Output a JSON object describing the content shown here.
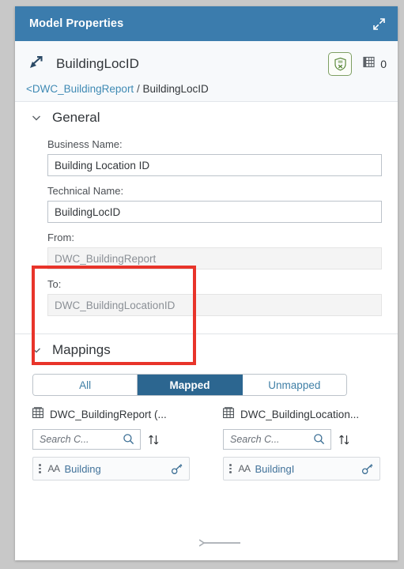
{
  "window": {
    "title": "Model Properties",
    "expand_icon": "expand-icon"
  },
  "object_header": {
    "type_icon": "association-arrow-icon",
    "name": "BuildingLocID",
    "shield_icon": "shield-validation-icon",
    "table_icon": "table-icon",
    "record_count": "0",
    "breadcrumb": {
      "parent_link": "<DWC_BuildingReport",
      "separator": "/",
      "current": "BuildingLocID"
    }
  },
  "general": {
    "title": "General",
    "chevron_icon": "chevron-down-icon",
    "fields": [
      {
        "label": "Business Name:",
        "value": "Building Location ID",
        "placeholder": "",
        "disabled": false,
        "name": "business-name-field"
      },
      {
        "label": "Technical Name:",
        "value": "BuildingLocID",
        "placeholder": "",
        "disabled": false,
        "name": "technical-name-field"
      },
      {
        "label": "From:",
        "value": "DWC_BuildingReport",
        "placeholder": "",
        "disabled": true,
        "name": "from-field"
      },
      {
        "label": "To:",
        "value": "DWC_BuildingLocationID",
        "placeholder": "",
        "disabled": true,
        "name": "to-field"
      }
    ]
  },
  "mappings": {
    "title": "Mappings",
    "chevron_icon": "chevron-down-icon",
    "filter_tabs": [
      {
        "label": "All",
        "active": false
      },
      {
        "label": "Mapped",
        "active": true
      },
      {
        "label": "Unmapped",
        "active": false
      }
    ],
    "source": {
      "entity_icon": "table-grid-icon",
      "entity_label": "DWC_BuildingReport (...",
      "search_placeholder": "Search C...",
      "search_value": "",
      "search_icon": "search-icon",
      "sort_icon": "sort-arrows-icon",
      "columns": [
        {
          "grip_icon": "drag-handle-icon",
          "type_icon": "AA",
          "label": "Building",
          "key_icon": "key-icon"
        }
      ]
    },
    "target": {
      "entity_icon": "table-grid-icon",
      "entity_label": "DWC_BuildingLocation...",
      "search_placeholder": "Search C...",
      "search_value": "",
      "search_icon": "search-icon",
      "sort_icon": "sort-arrows-icon",
      "columns": [
        {
          "grip_icon": "drag-handle-icon",
          "type_icon": "AA",
          "label": "BuildingI",
          "key_icon": "key-icon"
        }
      ]
    },
    "connector_icon": "mapping-connector-line"
  },
  "annotation": {
    "highlight_color": "#e8342a",
    "name": "from-to-highlight-box"
  },
  "colors": {
    "titlebar": "#3b7cad",
    "accent_active": "#2c6690",
    "link": "#3f8ab4",
    "shield_green": "#7e9f63"
  }
}
